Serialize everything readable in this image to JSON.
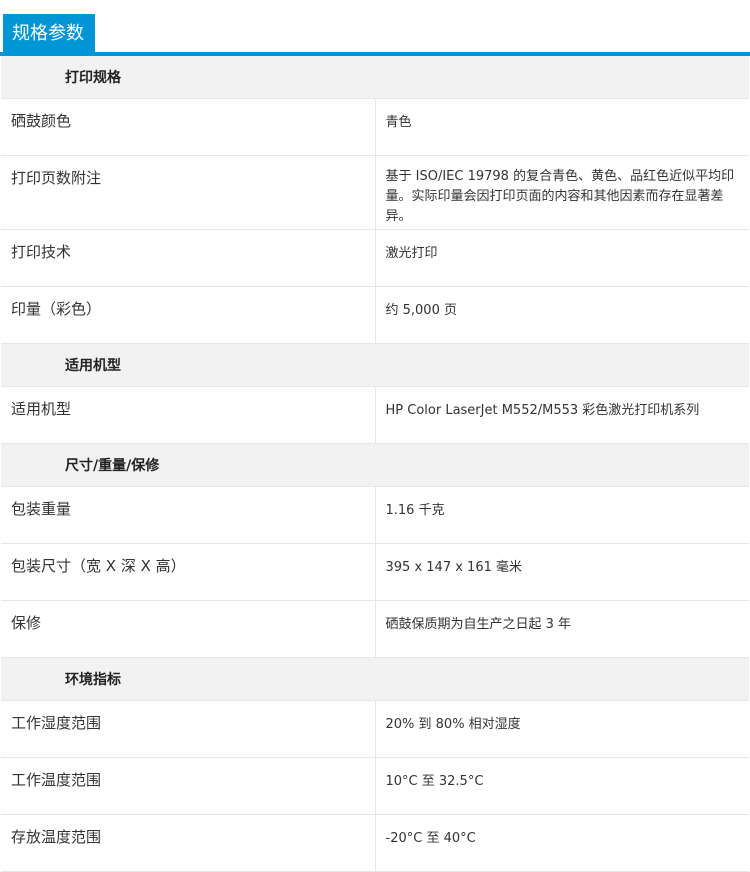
{
  "header": {
    "title": "规格参数"
  },
  "sections": [
    {
      "title": "打印规格",
      "rows": [
        {
          "label": "硒鼓颜色",
          "value": "青色"
        },
        {
          "label": "打印页数附注",
          "value": "基于 ISO/IEC 19798 的复合青色、黄色、品红色近似平均印量。实际印量会因打印页面的内容和其他因素而存在显著差异。"
        },
        {
          "label": "打印技术",
          "value": "激光打印"
        },
        {
          "label": "印量（彩色）",
          "value": "约 5,000 页"
        }
      ]
    },
    {
      "title": "适用机型",
      "rows": [
        {
          "label": "适用机型",
          "value": "HP Color LaserJet M552/M553 彩色激光打印机系列"
        }
      ]
    },
    {
      "title": "尺寸/重量/保修",
      "rows": [
        {
          "label": "包装重量",
          "value": "1.16 千克"
        },
        {
          "label": "包装尺寸（宽 X 深 X 高）",
          "value": "395 x 147 x 161 毫米"
        },
        {
          "label": "保修",
          "value": "硒鼓保质期为自生产之日起 3 年"
        }
      ]
    },
    {
      "title": "环境指标",
      "rows": [
        {
          "label": "工作湿度范围",
          "value": "20% 到 80% 相对湿度"
        },
        {
          "label": "工作温度范围",
          "value": "10°C 至 32.5°C"
        },
        {
          "label": "存放温度范围",
          "value": "-20°C 至 40°C"
        }
      ]
    }
  ],
  "colors": {
    "accent": "#0096d6",
    "section_bg": "#f2f2f2",
    "border": "#e6e6e6"
  }
}
